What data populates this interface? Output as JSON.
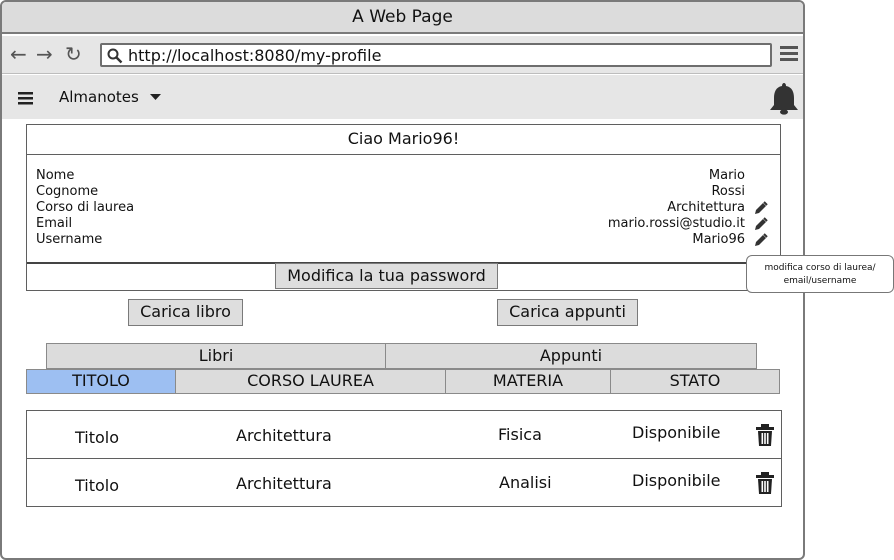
{
  "window": {
    "title": "A Web Page"
  },
  "browser": {
    "url": "http://localhost:8080/my-profile"
  },
  "menu": {
    "brand": "Almanotes"
  },
  "profile": {
    "greeting": "Ciao Mario96!",
    "fields": [
      {
        "label": "Nome",
        "value": "Mario",
        "editable": false
      },
      {
        "label": "Cognome",
        "value": "Rossi",
        "editable": false
      },
      {
        "label": "Corso di laurea",
        "value": "Architettura",
        "editable": true
      },
      {
        "label": "Email",
        "value": "mario.rossi@studio.it",
        "editable": true
      },
      {
        "label": "Username",
        "value": "Mario96",
        "editable": true
      }
    ],
    "change_password_label": "Modifica la tua password",
    "edit_tooltip": "modifica corso di laurea/ email/username"
  },
  "actions": {
    "upload_book_label": "Carica libro",
    "upload_notes_label": "Carica appunti"
  },
  "tabs": [
    {
      "label": "Libri"
    },
    {
      "label": "Appunti"
    }
  ],
  "table": {
    "columns": [
      "TITOLO",
      "CORSO LAUREA",
      "MATERIA",
      "STATO"
    ],
    "active_column": "TITOLO",
    "rows": [
      {
        "titolo": "Titolo",
        "corso": "Architettura",
        "materia": "Fisica",
        "stato": "Disponibile"
      },
      {
        "titolo": "Titolo",
        "corso": "Architettura",
        "materia": "Analisi",
        "stato": "Disponibile"
      }
    ]
  },
  "colors": {
    "active_column_bg": "#9dbff2",
    "chrome_bg": "#e6e6e6"
  }
}
